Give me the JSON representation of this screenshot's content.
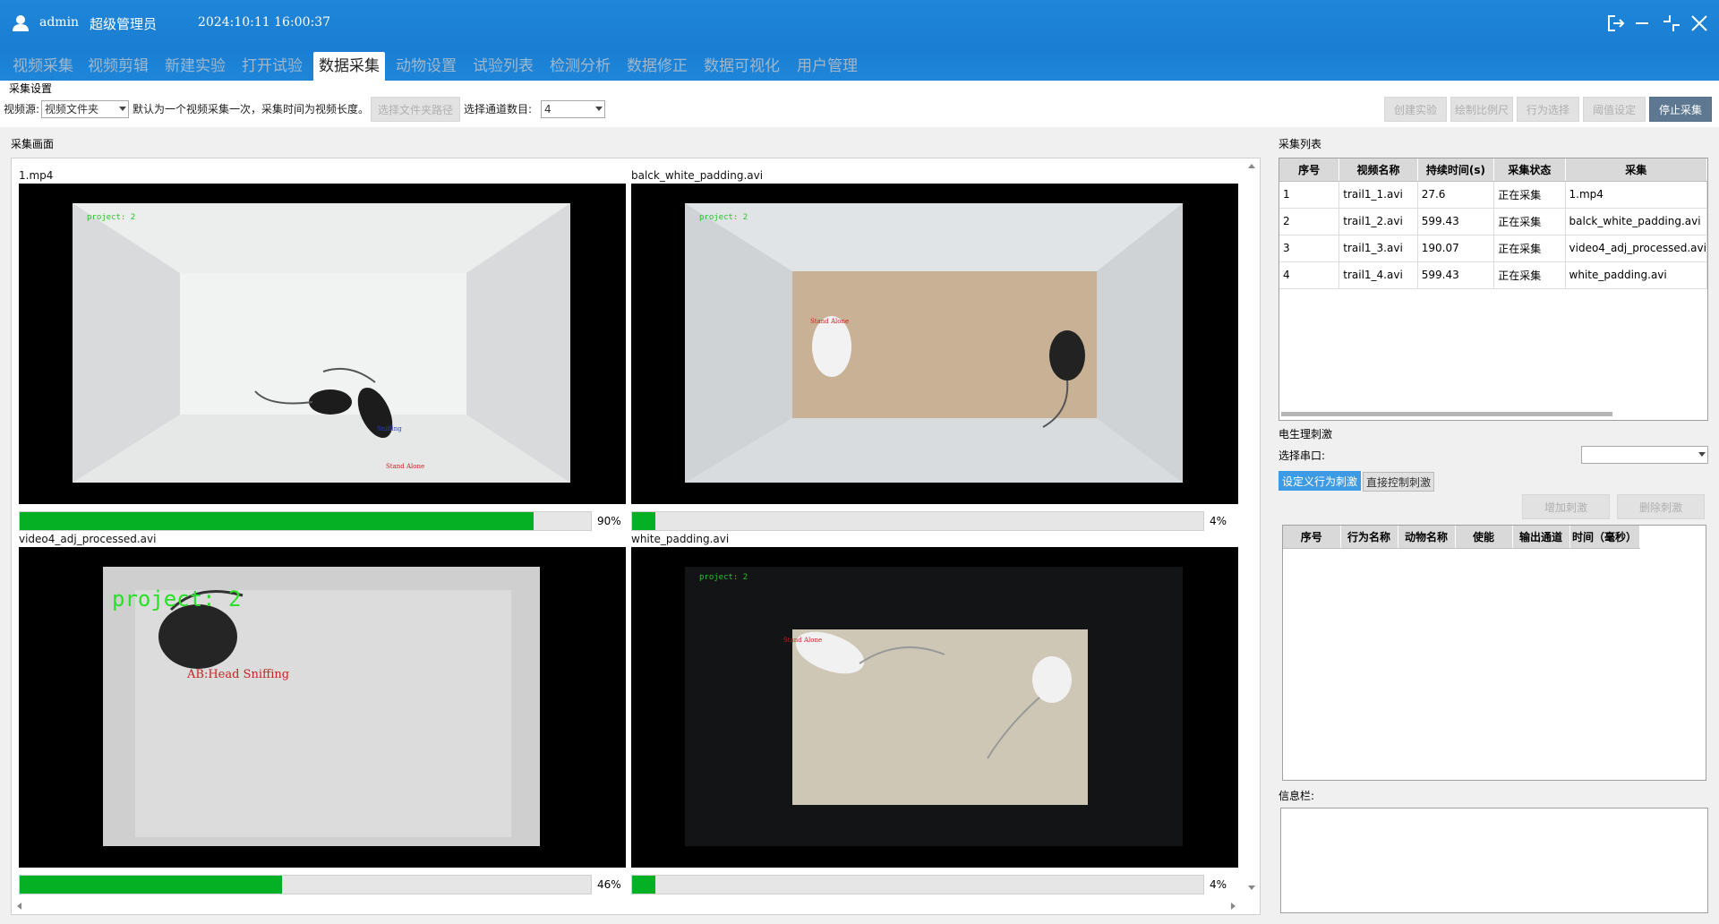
{
  "titlebar": {
    "user": "admin",
    "role": "超级管理员",
    "datetime": "2024:10:11 16:00:37"
  },
  "tabs": [
    "视频采集",
    "视频剪辑",
    "新建实验",
    "打开试验",
    "数据采集",
    "动物设置",
    "试验列表",
    "检测分析",
    "数据修正",
    "数据可视化",
    "用户管理"
  ],
  "active_tab": "数据采集",
  "settings": {
    "section_title": "采集设置",
    "source_label": "视频源:",
    "source_value": "视频文件夹",
    "hint": "默认为一个视频采集一次，采集时间为视频长度。",
    "select_folder_button": "选择文件夹路径",
    "channel_label": "选择通道数目:",
    "channel_value": "4",
    "buttons": {
      "create": "创建实验",
      "scale": "绘制比例尺",
      "behavior": "行为选择",
      "threshold": "阈值设定",
      "stop": "停止采集"
    }
  },
  "capture": {
    "title": "采集画面",
    "videos": [
      {
        "name": "1.mp4",
        "progress": 90,
        "progress_label": "90%",
        "overlay": "project: 2",
        "labels": [
          "Sniffing",
          "Stand Alone"
        ]
      },
      {
        "name": "balck_white_padding.avi",
        "progress": 4,
        "progress_label": "4%",
        "overlay": "project: 2",
        "labels": [
          "Stand Alone"
        ]
      },
      {
        "name": "video4_adj_processed.avi",
        "progress": 46,
        "progress_label": "46%",
        "overlay": "project: 2",
        "labels": [
          "AB:Head Sniffing"
        ]
      },
      {
        "name": "white_padding.avi",
        "progress": 4,
        "progress_label": "4%",
        "overlay": "project: 2",
        "labels": [
          "Stand Alone"
        ]
      }
    ]
  },
  "collection_list": {
    "title": "采集列表",
    "columns": [
      "序号",
      "视频名称",
      "持续时间(s)",
      "采集状态",
      "采集"
    ],
    "rows": [
      [
        "1",
        "trail1_1.avi",
        "27.6",
        "正在采集",
        "1.mp4"
      ],
      [
        "2",
        "trail1_2.avi",
        "599.43",
        "正在采集",
        "balck_white_padding.avi"
      ],
      [
        "3",
        "trail1_3.avi",
        "190.07",
        "正在采集",
        "video4_adj_processed.avi"
      ],
      [
        "4",
        "trail1_4.avi",
        "599.43",
        "正在采集",
        "white_padding.avi"
      ]
    ]
  },
  "stimulation": {
    "title": "电生理刺激",
    "port_label": "选择串口:",
    "port_value": "",
    "tabs": [
      "设定义行为刺激",
      "直接控制刺激"
    ],
    "add_button": "增加刺激",
    "delete_button": "删除刺激",
    "columns": [
      "序号",
      "行为名称",
      "动物名称",
      "使能",
      "输出通道",
      "时间（毫秒）"
    ]
  },
  "info": {
    "title": "信息栏:"
  },
  "colors": {
    "titlebar": "#1f86d9",
    "progress": "#06b025",
    "stop_button": "#5e7891"
  }
}
